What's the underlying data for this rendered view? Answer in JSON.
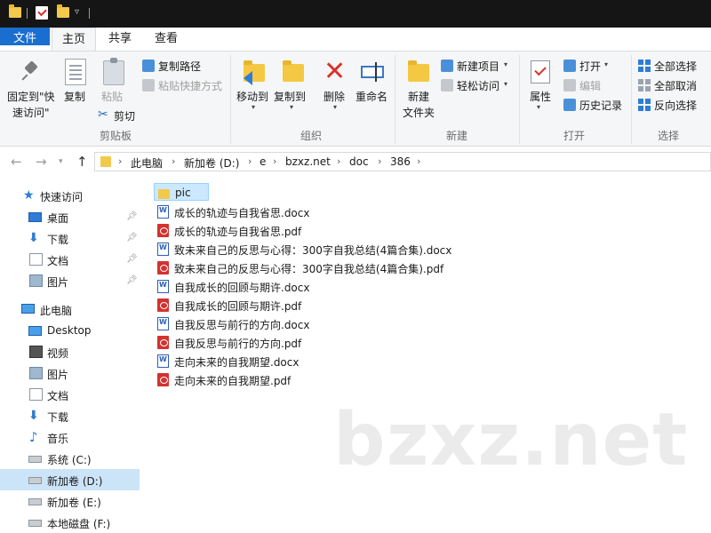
{
  "ribbon_tabs": [
    "文件",
    "主页",
    "共享",
    "查看"
  ],
  "ribbon": {
    "clipboard": {
      "pin_quick_access": "固定到\"快",
      "pin_quick_access_2": "速访问\"",
      "copy": "复制",
      "paste": "粘贴",
      "copy_path": "复制路径",
      "paste_shortcut": "粘贴快捷方式",
      "cut": "剪切",
      "group": "剪贴板"
    },
    "organize": {
      "move_to": "移动到",
      "copy_to": "复制到",
      "delete": "删除",
      "rename": "重命名",
      "group": "组织"
    },
    "new": {
      "new_folder": "新建",
      "new_folder_2": "文件夹",
      "new_item": "新建项目",
      "easy_access": "轻松访问",
      "group": "新建"
    },
    "open": {
      "properties": "属性",
      "open": "打开",
      "edit": "编辑",
      "history": "历史记录",
      "group": "打开"
    },
    "select": {
      "select_all": "全部选择",
      "select_none": "全部取消",
      "invert": "反向选择",
      "group": "选择"
    }
  },
  "breadcrumb": [
    "此电脑",
    "新加卷 (D:)",
    "e",
    "bzxz.net",
    "doc",
    "386"
  ],
  "sidebar": {
    "quick_access": "快速访问",
    "quick_items": [
      "桌面",
      "下载",
      "文档",
      "图片"
    ],
    "this_pc": "此电脑",
    "pc_items": [
      "Desktop",
      "视频",
      "图片",
      "文档",
      "下载",
      "音乐",
      "系统 (C:)",
      "新加卷 (D:)",
      "新加卷 (E:)",
      "本地磁盘 (F:)"
    ]
  },
  "files": [
    {
      "name": "pic",
      "type": "folder"
    },
    {
      "name": "成长的轨迹与自我省思.docx",
      "type": "docx"
    },
    {
      "name": "成长的轨迹与自我省思.pdf",
      "type": "pdf"
    },
    {
      "name": "致未来自己的反思与心得：300字自我总结(4篇合集).docx",
      "type": "docx"
    },
    {
      "name": "致未来自己的反思与心得：300字自我总结(4篇合集).pdf",
      "type": "pdf"
    },
    {
      "name": "自我成长的回顾与期许.docx",
      "type": "docx"
    },
    {
      "name": "自我成长的回顾与期许.pdf",
      "type": "pdf"
    },
    {
      "name": "自我反思与前行的方向.docx",
      "type": "docx"
    },
    {
      "name": "自我反思与前行的方向.pdf",
      "type": "pdf"
    },
    {
      "name": "走向未来的自我期望.docx",
      "type": "docx"
    },
    {
      "name": "走向未来的自我期望.pdf",
      "type": "pdf"
    }
  ],
  "watermark": "bzxz.net"
}
